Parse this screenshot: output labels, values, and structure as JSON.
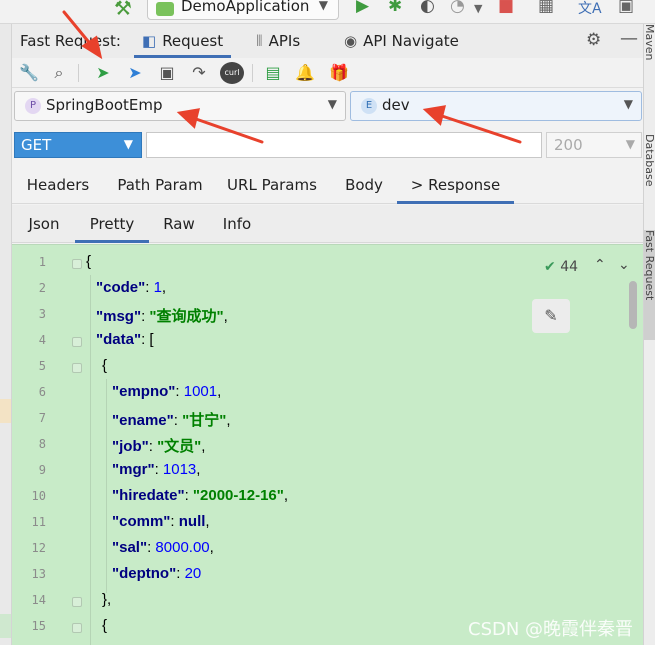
{
  "ide_toolbar": {
    "run_config": "DemoApplication"
  },
  "tool_window": {
    "title": "Fast Request:",
    "tabs": [
      {
        "label": "Request",
        "icon": "request-icon"
      },
      {
        "label": "APIs",
        "icon": "apis-icon"
      },
      {
        "label": "API Navigate",
        "icon": "navigate-icon"
      }
    ],
    "right_sidebar": [
      "Maven",
      "Database",
      "Fast Request"
    ]
  },
  "toolbar": {
    "icons": [
      "wrench-icon",
      "search-icon",
      "send-icon",
      "send-download-icon",
      "save-icon",
      "redo-icon",
      "curl-icon",
      "docs-icon",
      "notification-icon",
      "gift-icon"
    ],
    "curl_label": "curl"
  },
  "project": {
    "badge": "P",
    "value": "SpringBootEmp"
  },
  "env": {
    "badge": "E",
    "value": "dev"
  },
  "request": {
    "method": "GET",
    "url": "",
    "status": "200"
  },
  "request_tabs": [
    {
      "label": "Headers"
    },
    {
      "label": "Path Param"
    },
    {
      "label": "URL Params"
    },
    {
      "label": "Body"
    },
    {
      "label": "> Response",
      "active": true
    }
  ],
  "response_tabs": [
    {
      "label": "Json"
    },
    {
      "label": "Pretty",
      "active": true
    },
    {
      "label": "Raw"
    },
    {
      "label": "Info"
    }
  ],
  "editor": {
    "inspection_count": "44",
    "line_numbers": [
      "1",
      "2",
      "3",
      "4",
      "5",
      "6",
      "7",
      "8",
      "9",
      "10",
      "11",
      "12",
      "13",
      "14",
      "15"
    ],
    "json": {
      "code_key": "\"code\"",
      "code_val": "1",
      "msg_key": "\"msg\"",
      "msg_val": "\"查询成功\"",
      "data_key": "\"data\"",
      "empno_key": "\"empno\"",
      "empno_val": "1001",
      "ename_key": "\"ename\"",
      "ename_val": "\"甘宁\"",
      "job_key": "\"job\"",
      "job_val": "\"文员\"",
      "mgr_key": "\"mgr\"",
      "mgr_val": "1013",
      "hiredate_key": "\"hiredate\"",
      "hiredate_val": "\"2000-12-16\"",
      "comm_key": "\"comm\"",
      "comm_val": "null",
      "sal_key": "\"sal\"",
      "sal_val": "8000.00",
      "deptno_key": "\"deptno\"",
      "deptno_val": "20"
    }
  },
  "watermark": "CSDN @晚霞伴秦晋",
  "colors": {
    "editor_bg": "#c8ebc8",
    "method_bg": "#3d8fd8",
    "accent": "#3f6fb5",
    "annotation": "#e8412c"
  }
}
